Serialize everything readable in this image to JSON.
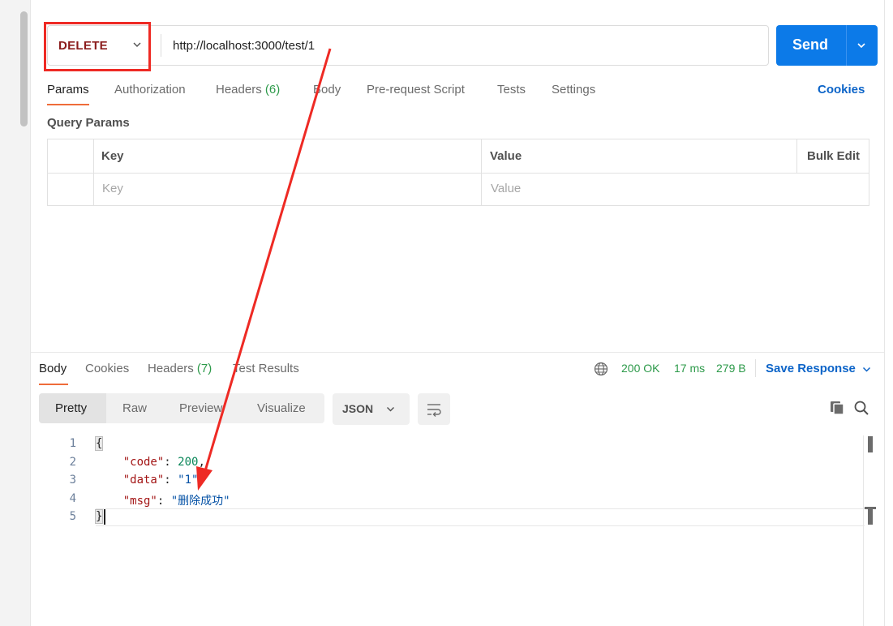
{
  "request": {
    "method": "DELETE",
    "url": "http://localhost:3000/test/1",
    "send_label": "Send"
  },
  "request_tabs": [
    {
      "label": "Params",
      "count": ""
    },
    {
      "label": "Authorization",
      "count": ""
    },
    {
      "label": "Headers",
      "count": "(6)"
    },
    {
      "label": "Body",
      "count": ""
    },
    {
      "label": "Pre-request Script",
      "count": ""
    },
    {
      "label": "Tests",
      "count": ""
    },
    {
      "label": "Settings",
      "count": ""
    }
  ],
  "cookies_link": "Cookies",
  "query_params": {
    "title": "Query Params",
    "headers": {
      "key": "Key",
      "value": "Value",
      "bulk_edit": "Bulk Edit"
    },
    "placeholders": {
      "key": "Key",
      "value": "Value"
    }
  },
  "response": {
    "tabs": [
      {
        "label": "Body",
        "count": ""
      },
      {
        "label": "Cookies",
        "count": ""
      },
      {
        "label": "Headers",
        "count": "(7)"
      },
      {
        "label": "Test Results",
        "count": ""
      }
    ],
    "status": "200 OK",
    "time": "17 ms",
    "size": "279 B",
    "save_label": "Save Response",
    "view_modes": [
      "Pretty",
      "Raw",
      "Preview",
      "Visualize"
    ],
    "format": "JSON",
    "code_lines": [
      {
        "n": "1",
        "text": "{"
      },
      {
        "n": "2",
        "key": "\"code\"",
        "sep": ": ",
        "value": "200",
        "tail": ","
      },
      {
        "n": "3",
        "key": "\"data\"",
        "sep": ": ",
        "value": "\"1\"",
        "tail": ","
      },
      {
        "n": "4",
        "key": "\"msg\"",
        "sep": ": ",
        "value": "\"删除成功\"",
        "tail": ""
      },
      {
        "n": "5",
        "text": "}"
      }
    ]
  },
  "colors": {
    "accent_blue": "#0c7ae8",
    "annotation_red": "#ee2a24",
    "tab_underline": "#ef6c3a",
    "status_green": "#2d9a4a",
    "method_red": "#8b1c1c"
  },
  "icons": [
    "chevron-down-icon",
    "globe-icon",
    "copy-icon",
    "search-icon",
    "wrap-lines-icon"
  ]
}
